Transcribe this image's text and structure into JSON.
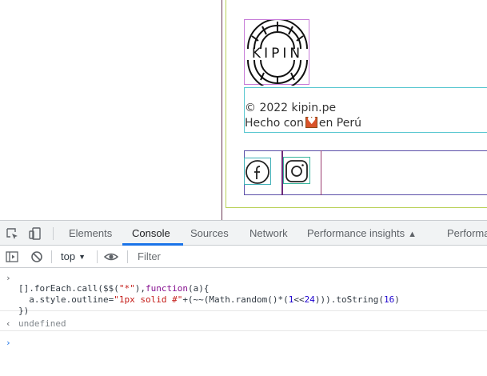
{
  "page": {
    "logo_text": "KIPIN",
    "copyright": "© 2022 kipin.pe",
    "made_in_prefix": "Hecho con",
    "made_in_suffix": "en Perú",
    "social": [
      {
        "name": "facebook",
        "icon": "facebook-icon"
      },
      {
        "name": "instagram",
        "icon": "instagram-icon"
      }
    ]
  },
  "devtools": {
    "tabs": [
      {
        "label": "Elements",
        "active": false
      },
      {
        "label": "Console",
        "active": true
      },
      {
        "label": "Sources",
        "active": false
      },
      {
        "label": "Network",
        "active": false
      },
      {
        "label": "Performance insights",
        "active": false
      },
      {
        "label": "Performa",
        "active": false
      }
    ],
    "toolbar": {
      "context": "top",
      "filter_placeholder": "Filter"
    },
    "console": {
      "input_lines": [
        "[].forEach.call($$(\"*\"),function(a){",
        "  a.style.outline=\"1px solid #\"+(~~(Math.random()*(1<<24))).toString(16)",
        "})"
      ],
      "result": "undefined"
    },
    "colors": {
      "accent": "#1a73e8",
      "tab_bar_bg": "#f1f3f4"
    }
  }
}
